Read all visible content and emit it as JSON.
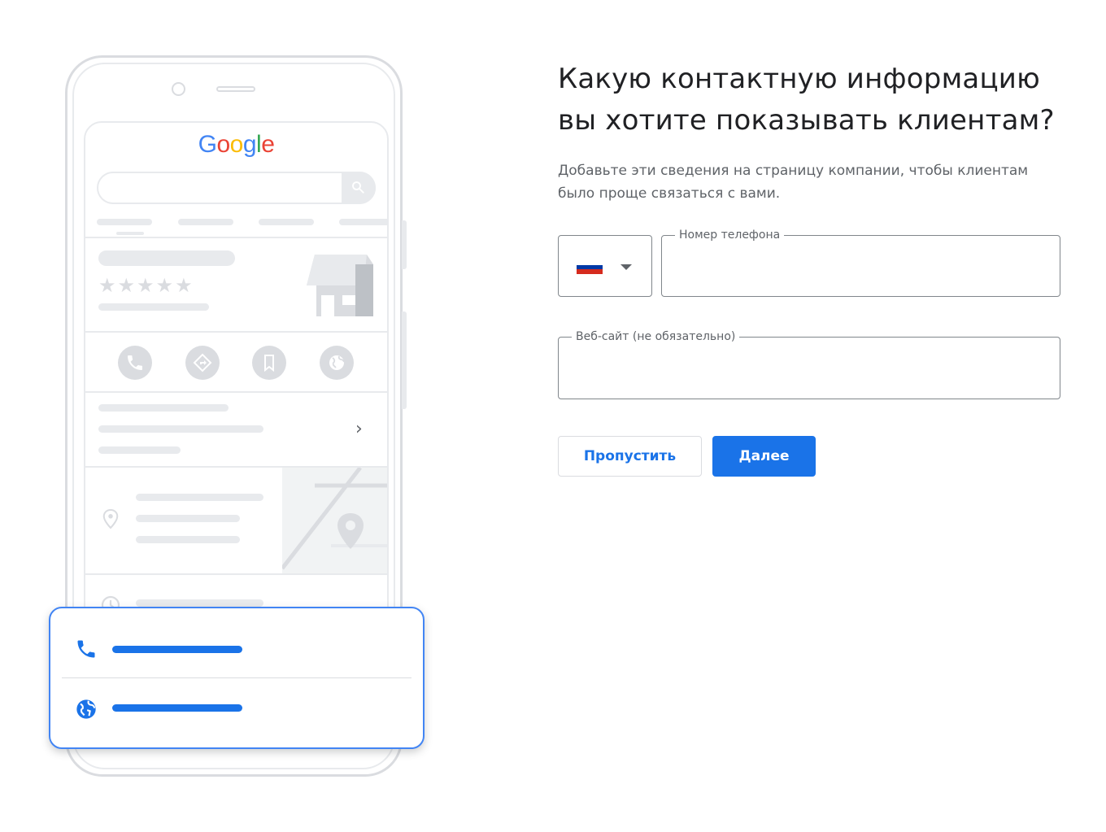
{
  "illustration": {
    "logo_letters": [
      "G",
      "o",
      "o",
      "g",
      "l",
      "e"
    ],
    "stars": "★★★★★"
  },
  "form": {
    "title_line1": "Какую контактную информацию",
    "title_line2": "вы хотите показывать клиентам?",
    "subtitle": "Добавьте эти сведения на страницу компании, чтобы клиентам было проще связаться с вами.",
    "country": {
      "icon": "russia-flag-icon"
    },
    "phone": {
      "label": "Номер телефона",
      "value": ""
    },
    "website": {
      "label": "Веб-сайт (не обязательно)",
      "value": ""
    },
    "skip_label": "Пропустить",
    "next_label": "Далее"
  },
  "colors": {
    "primary": "#1a73e8",
    "border": "#80868b",
    "illustration_gray": "#e8eaed"
  }
}
